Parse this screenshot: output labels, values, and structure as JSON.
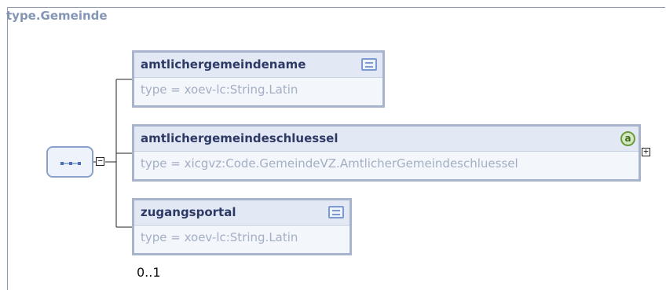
{
  "complex_type": {
    "title": "type.Gemeinde"
  },
  "sequence": {
    "icon": "sequence-dots-icon",
    "collapse_symbol": "−"
  },
  "elements": [
    {
      "name": "amtlichergemeindename",
      "type": "type = xoev-lc:String.Latin",
      "icon": "documentation-icon"
    },
    {
      "name": "amtlichergemeindeschluessel",
      "type": "type = xicgvz:Code.GemeindeVZ.AmtlicherGemeindeschluessel",
      "icon": "attribute-icon",
      "icon_glyph": "a",
      "expand_symbol": "+"
    },
    {
      "name": "zugangsportal",
      "type": "type = xoev-lc:String.Latin",
      "icon": "documentation-icon",
      "cardinality": "0..1"
    }
  ],
  "colors": {
    "border": "#a8b4cb",
    "header": "#e2e9f4",
    "title": "#8496b5",
    "name": "#2e3a66",
    "type": "#a4aec4"
  }
}
